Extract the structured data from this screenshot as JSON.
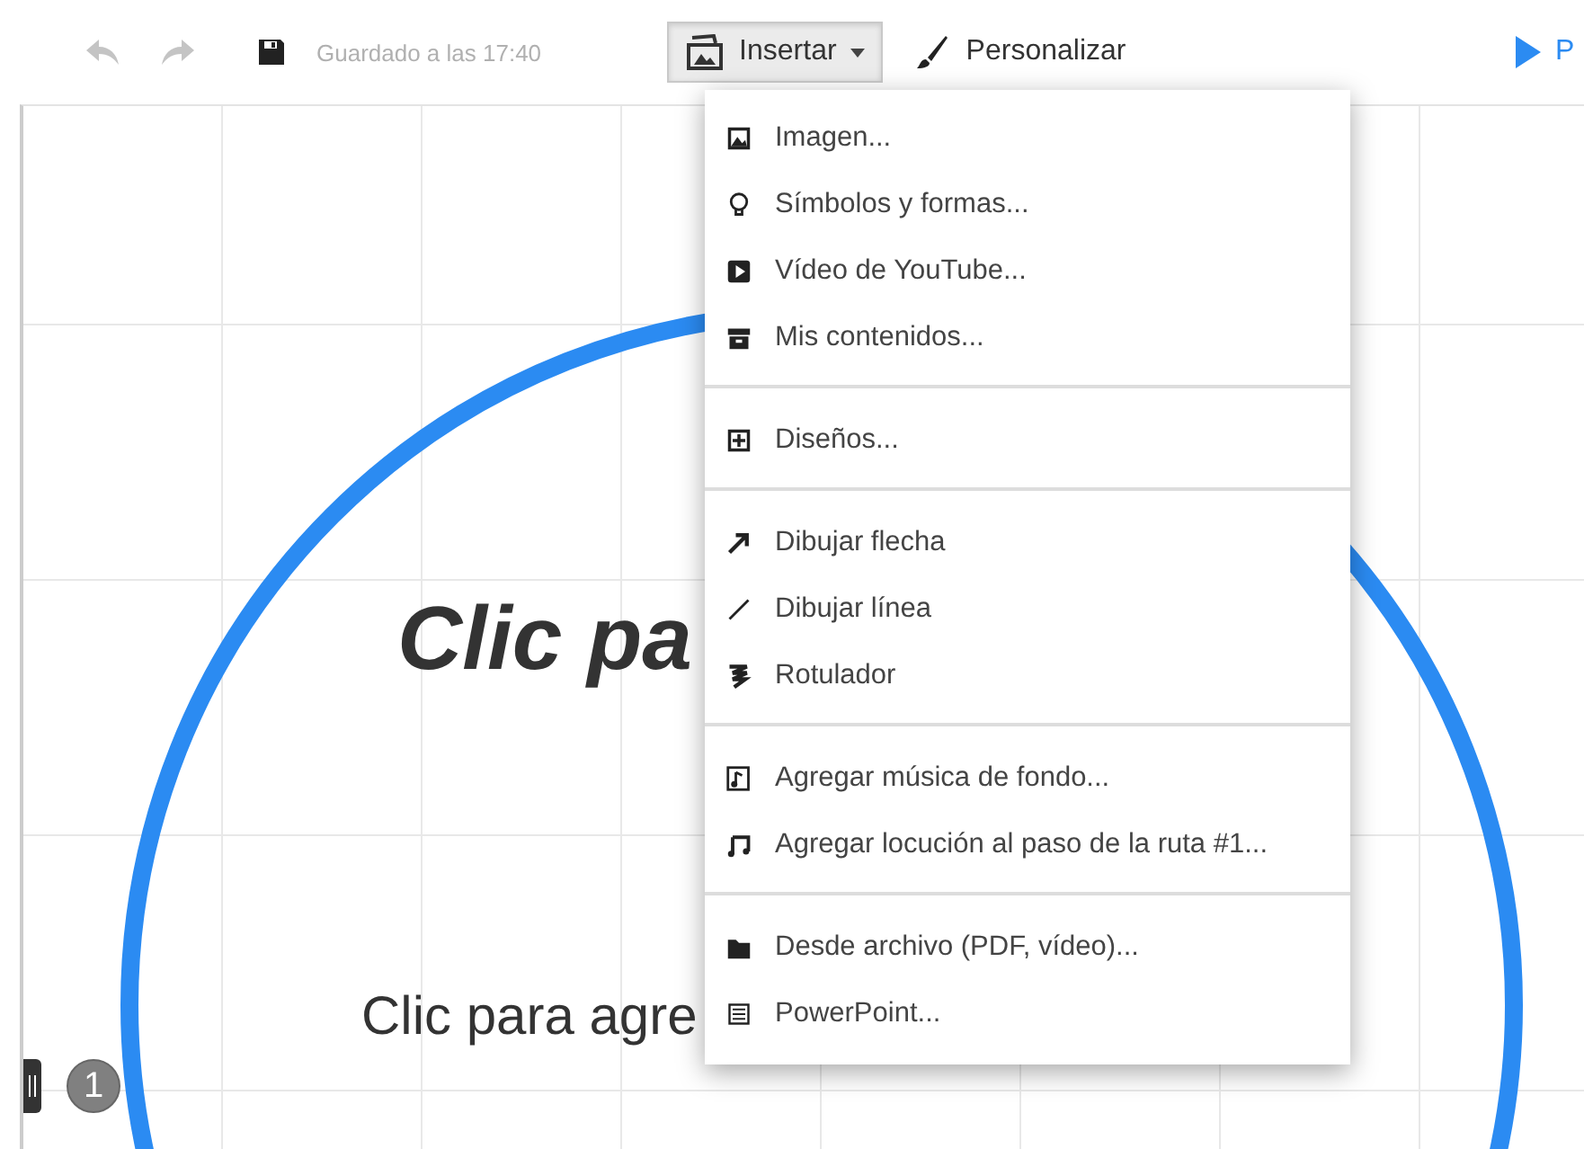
{
  "toolbar": {
    "undo": {
      "disabled": true
    },
    "redo": {
      "disabled": true
    },
    "saved_status": "Guardado a las 17:40",
    "insert_button": {
      "label": "Insertar",
      "expanded": true
    },
    "customize_button": {
      "label": "Personalizar"
    },
    "present_button": {
      "label": "P"
    }
  },
  "canvas": {
    "title": "Clic pa",
    "subtitle": "Clic para agre",
    "step_number": "1"
  },
  "insert_menu": {
    "sections": [
      {
        "items": [
          {
            "label": "Imagen..."
          },
          {
            "label": "Símbolos y formas..."
          },
          {
            "label": "Vídeo de YouTube..."
          },
          {
            "label": "Mis contenidos..."
          }
        ]
      },
      {
        "items": [
          {
            "label": "Diseños..."
          }
        ]
      },
      {
        "items": [
          {
            "label": "Dibujar flecha"
          },
          {
            "label": "Dibujar línea"
          },
          {
            "label": "Rotulador"
          }
        ]
      },
      {
        "items": [
          {
            "label": "Agregar música de fondo..."
          },
          {
            "label": "Agregar locución al paso de la ruta #1..."
          }
        ]
      },
      {
        "items": [
          {
            "label": "Desde archivo (PDF, vídeo)..."
          },
          {
            "label": "PowerPoint..."
          }
        ]
      }
    ]
  }
}
